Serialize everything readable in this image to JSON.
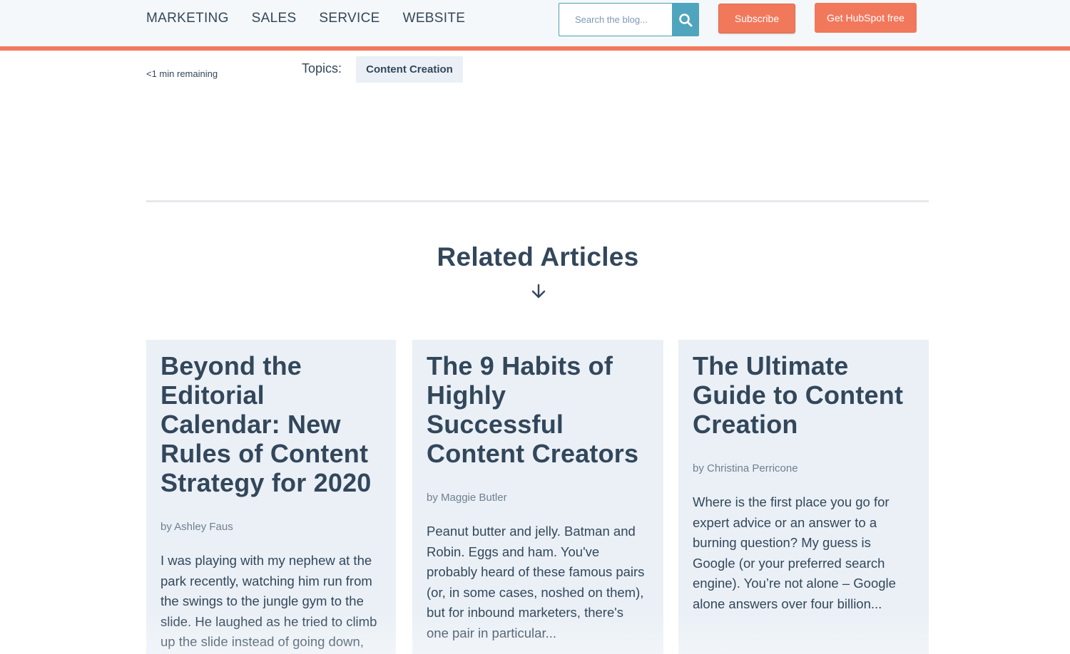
{
  "nav": {
    "items": [
      "MARKETING",
      "SALES",
      "SERVICE",
      "WEBSITE"
    ]
  },
  "search": {
    "placeholder": "Search the blog...",
    "icon": "search-icon"
  },
  "header_buttons": {
    "subscribe": "Subscribe",
    "cta": "Get HubSpot free"
  },
  "article_meta": {
    "remaining": "<1 min remaining",
    "topics_label": "Topics:",
    "topic": "Content Creation"
  },
  "related": {
    "title": "Related Articles",
    "arrow_icon": "arrow-down-icon",
    "cards": [
      {
        "title": "Beyond the Editorial Calendar: New Rules of Content Strategy for 2020",
        "author": "by Ashley Faus",
        "excerpt": "I was playing with my nephew at the park recently, watching him run from the swings to the jungle gym to the slide. He laughed as he tried to climb up the slide instead of going down, and I realized..."
      },
      {
        "title": "The 9 Habits of Highly Successful Content Creators",
        "author": "by Maggie Butler",
        "excerpt": "Peanut butter and jelly. Batman and Robin. Eggs and ham. You've probably heard of these famous pairs (or, in some cases, noshed on them), but for inbound marketers, there's one pair in particular..."
      },
      {
        "title": "The Ultimate Guide to Content Creation",
        "author": "by Christina Perricone",
        "excerpt": "Where is the first place you go for expert advice or an answer to a burning question? My guess is Google (or your preferred search engine). You’re not alone – Google alone answers over four billion..."
      }
    ]
  },
  "colors": {
    "accent": "#f2785c",
    "search_button": "#4fa5bd",
    "text": "#33475b",
    "card_bg": "#eaf0f6"
  }
}
